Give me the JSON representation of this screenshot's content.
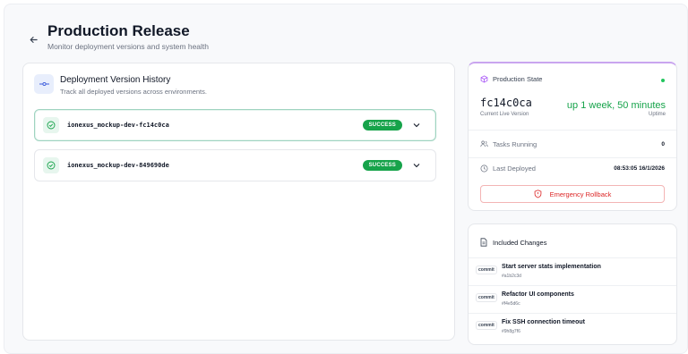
{
  "header": {
    "title": "Production Release",
    "subtitle": "Monitor deployment versions and system health"
  },
  "history": {
    "title": "Deployment Version History",
    "subtitle": "Track all deployed versions across environments.",
    "versions": [
      {
        "name": "ionexus_mockup-dev-fc14c0ca",
        "status": "SUCCESS"
      },
      {
        "name": "ionexus_mockup-dev-849690de",
        "status": "SUCCESS"
      }
    ]
  },
  "production_state": {
    "title": "Production State",
    "commit": "fc14c0ca",
    "commit_label": "Current Live Version",
    "uptime": "up 1 week, 50 minutes",
    "uptime_label": "Uptime",
    "tasks_label": "Tasks Running",
    "tasks_value": "0",
    "deployed_label": "Last Deployed",
    "deployed_value": "08:53:05 16/1/2026",
    "rollback_label": "Emergency Rollback"
  },
  "changes": {
    "title": "Included Changes",
    "items": [
      {
        "tag": "commit",
        "message": "Start server stats implementation",
        "hash": "#a1b2c3d"
      },
      {
        "tag": "commit",
        "message": "Refactor UI components",
        "hash": "#f4e5d6c"
      },
      {
        "tag": "commit",
        "message": "Fix SSH connection timeout",
        "hash": "#9h8g7f6"
      }
    ]
  },
  "colors": {
    "accent_green": "#16a34a",
    "danger": "#dc2626",
    "purple_top": "#c9a5ef"
  }
}
